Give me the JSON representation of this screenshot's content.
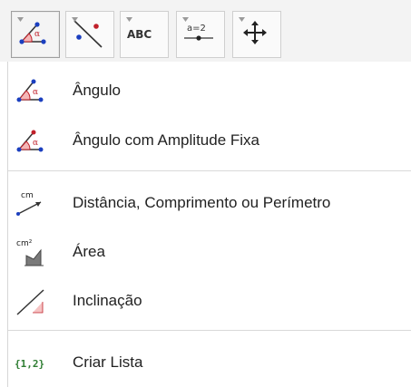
{
  "toolbar": {
    "buttons": [
      {
        "name": "angle",
        "icon": "angle-tool-icon",
        "active": true
      },
      {
        "name": "line",
        "icon": "line-tool-icon",
        "active": false
      },
      {
        "name": "text",
        "icon": "text-tool-icon",
        "label": "ABC",
        "active": false
      },
      {
        "name": "slider",
        "icon": "slider-tool-icon",
        "label": "a=2",
        "active": false
      },
      {
        "name": "move",
        "icon": "move-graphics-icon",
        "active": false
      }
    ]
  },
  "menu": {
    "items": [
      {
        "label": "Ângulo",
        "icon": "angle-icon"
      },
      {
        "label": "Ângulo com Amplitude Fixa",
        "icon": "angle-fixed-size-icon"
      },
      {
        "label": "Distância, Comprimento ou Perímetro",
        "icon": "distance-icon",
        "icon_text": "cm"
      },
      {
        "label": "Área",
        "icon": "area-icon",
        "icon_text": "cm²"
      },
      {
        "label": "Inclinação",
        "icon": "slope-icon"
      },
      {
        "label": "Criar Lista",
        "icon": "create-list-icon",
        "icon_text": "{1,2}"
      }
    ]
  },
  "colors": {
    "accent_blue": "#1b3fbf",
    "point_red": "#c0202a",
    "list_green": "#2e7d32",
    "slope_fill": "#f6c4c4"
  }
}
